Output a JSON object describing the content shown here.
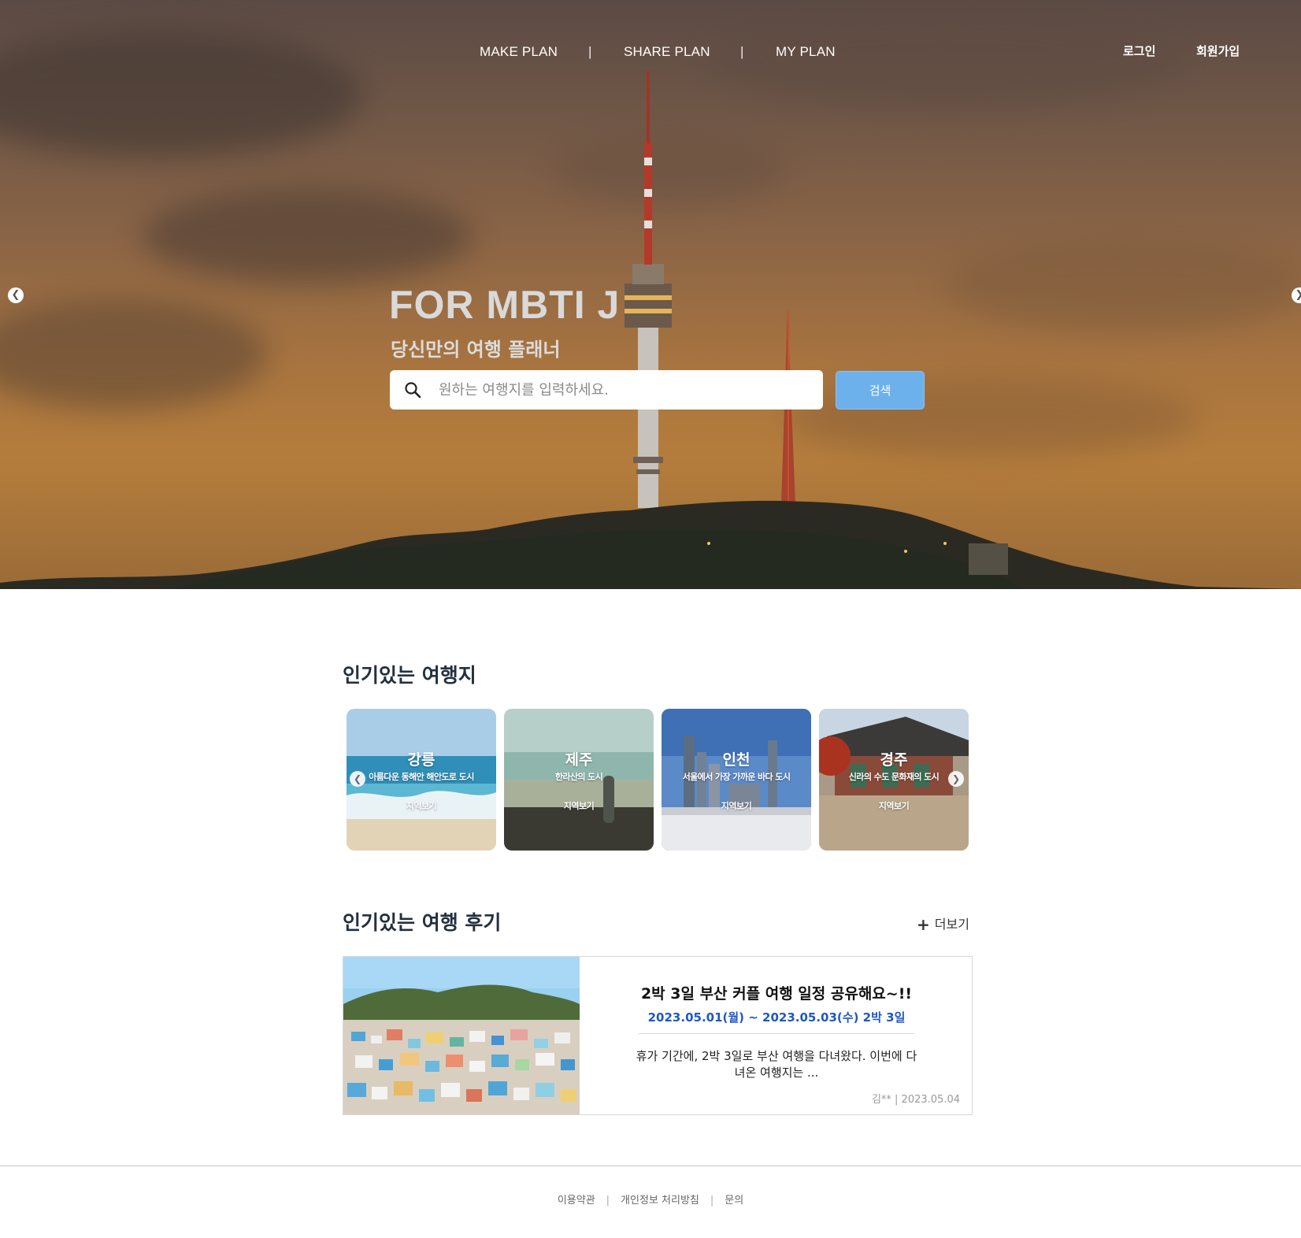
{
  "nav": {
    "make_plan": "MAKE PLAN",
    "share_plan": "SHARE PLAN",
    "my_plan": "MY PLAN",
    "separator": "|",
    "login": "로그인",
    "signup": "회원가입"
  },
  "hero": {
    "title": "FOR MBTI J",
    "subtitle": "당신만의 여행 플래너",
    "search_placeholder": "원하는 여행지를 입력하세요.",
    "search_button": "검색",
    "prev_icon": "chevron-left-icon",
    "next_icon": "chevron-right-icon"
  },
  "popular": {
    "title": "인기있는 여행지",
    "destinations": [
      {
        "name": "강릉",
        "desc": "아름다운 동해안 해안도로 도시",
        "more": "지역보기"
      },
      {
        "name": "제주",
        "desc": "한라산의 도시",
        "more": "지역보기"
      },
      {
        "name": "인천",
        "desc": "서울에서 가장 가까운 바다 도시",
        "more": "지역보기"
      },
      {
        "name": "경주",
        "desc": "신라의 수도 문화재의 도시",
        "more": "지역보기"
      }
    ]
  },
  "reviews": {
    "title": "인기있는 여행 후기",
    "more_plus": "+",
    "more": "더보기",
    "items": [
      {
        "title": "2박 3일 부산 커플 여행 일정 공유해요~!!",
        "period": "2023.05.01(월) ~ 2023.05.03(수) 2박 3일",
        "body": "휴가 기간에, 2박 3일로 부산 여행을 다녀왔다. 이번에 다녀온 여행지는 ...",
        "meta": "김** | 2023.05.04"
      }
    ]
  },
  "footer": {
    "terms": "이용약관",
    "privacy": "개인정보 처리방침",
    "contact": "문의",
    "separator": "|"
  },
  "colors": {
    "search_button": "#6cb1ec",
    "review_period": "#1f58c4",
    "section_title": "#233040"
  }
}
